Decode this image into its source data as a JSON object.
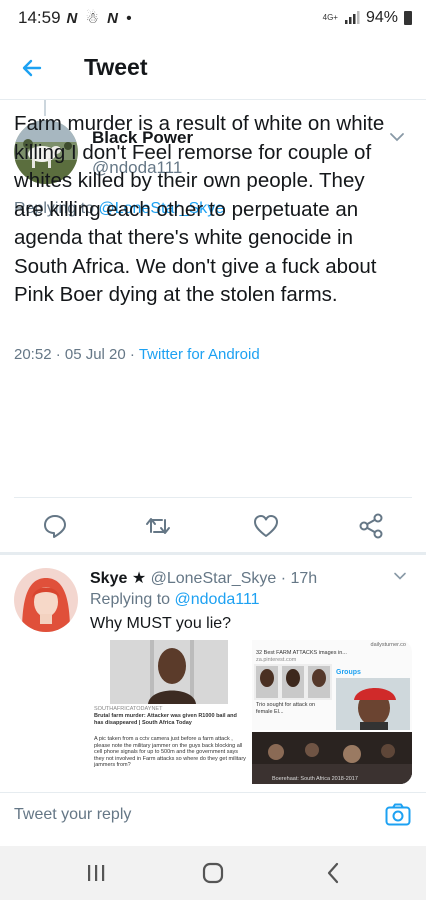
{
  "status_bar": {
    "time": "14:59",
    "app_icons": "N ☃ N •",
    "network": "4G+",
    "battery": "94%"
  },
  "header": {
    "title": "Tweet"
  },
  "main_tweet": {
    "display_name": "Black Power",
    "handle": "@ndoda111",
    "replying_prefix": "Replying to ",
    "replying_to": "@LoneStar_Skye",
    "text": "Farm murder is a result of white on white killing I don't Feel remorse for couple of whites killed by their own people. They are killing each other to perpetuate an agenda that there's white genocide in South Africa. We don't give a fuck about Pink Boer dying at the stolen farms.",
    "timestamp": "20:52 · 05 Jul 20 · ",
    "source": "Twitter for Android",
    "actions": [
      "reply-icon",
      "retweet-icon",
      "like-icon",
      "share-icon"
    ]
  },
  "reply_tweet": {
    "display_name": "Skye ★",
    "handle": "@LoneStar_Skye",
    "time_ago": "· 17h",
    "replying_prefix": "Replying to ",
    "replying_to": "@ndoda111",
    "text": "Why MUST you lie?",
    "media": {
      "cell1_caption_small": "SOUTHAFRICATODAYNET",
      "cell1_caption": "Brutal farm murder: Attacker was given R1000 bail and has disappeared | South Africa Today",
      "cell2_site": "dailysturner.co",
      "cell2_title": "32 Best FARM ATTACKS images in...",
      "cell2_source": "za.pinterest.com",
      "cell2_groups": "Groups",
      "cell2_caption": "Trio sought for attack on female El...",
      "cell3_text": "A pic taken from a cctv camera just before a farm attack , please note the military jammer on the guys back  blocking all cell phone signals for up to 500m and the government says they not involved in Farm attacks     so where do they get military jammers from?",
      "cell4_caption": "Boerehaat: South Africa 2018-2017"
    }
  },
  "composer": {
    "placeholder": "Tweet your reply"
  },
  "colors": {
    "accent": "#1da1f2",
    "secondary_text": "#657786",
    "divider": "#e6ecf0"
  }
}
